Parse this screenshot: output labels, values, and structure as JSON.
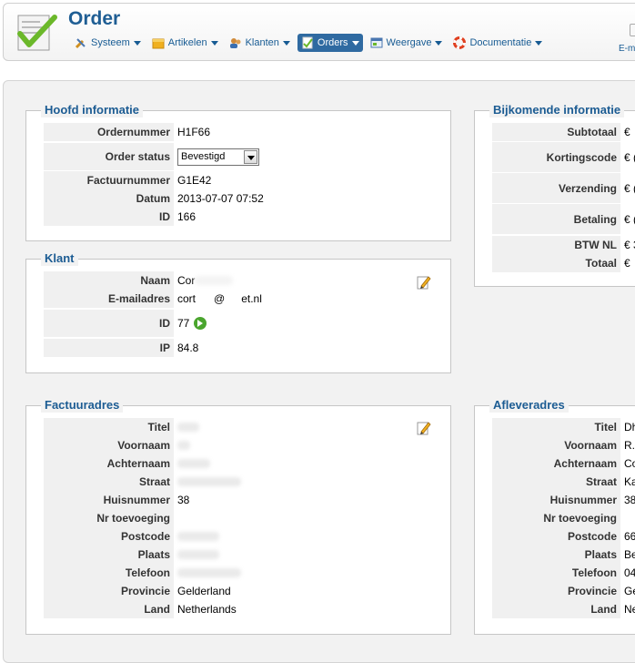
{
  "header": {
    "title": "Order",
    "email_link": "E-m"
  },
  "menu": [
    {
      "label": "Systeem",
      "icon": "tools-icon"
    },
    {
      "label": "Artikelen",
      "icon": "box-icon"
    },
    {
      "label": "Klanten",
      "icon": "users-icon"
    },
    {
      "label": "Orders",
      "icon": "orders-icon",
      "active": true
    },
    {
      "label": "Weergave",
      "icon": "view-icon"
    },
    {
      "label": "Documentatie",
      "icon": "lifebuoy-icon"
    }
  ],
  "hoofd": {
    "legend": "Hoofd informatie",
    "ordernummer_label": "Ordernummer",
    "ordernummer": "H1F66",
    "status_label": "Order status",
    "status": "Bevestigd",
    "factuurnummer_label": "Factuurnummer",
    "factuurnummer": "G1E42",
    "datum_label": "Datum",
    "datum": "2013-07-07 07:52",
    "id_label": "ID",
    "id": "166"
  },
  "bijkomend": {
    "legend": "Bijkomende informatie",
    "subtotaal_label": "Subtotaal",
    "subtotaal": "€",
    "kortingscode_label": "Kortingscode",
    "kortingscode": "€ (",
    "verzending_label": "Verzending",
    "verzending": "€ (",
    "betaling_label": "Betaling",
    "betaling": "€ (",
    "btw_label": "BTW NL",
    "btw": "€ 3",
    "totaal_label": "Totaal",
    "totaal": "€"
  },
  "klant": {
    "legend": "Klant",
    "naam_label": "Naam",
    "naam": "Cor",
    "email_label": "E-mailadres",
    "email_a": "cort",
    "email_b": "@",
    "email_c": "et.nl",
    "id_label": "ID",
    "id": "77",
    "ip_label": "IP",
    "ip": "84.8"
  },
  "factuuradres": {
    "legend": "Factuuradres",
    "titel_label": "Titel",
    "voornaam_label": "Voornaam",
    "achternaam_label": "Achternaam",
    "straat_label": "Straat",
    "huisnummer_label": "Huisnummer",
    "huisnummer": "38",
    "nr_toevoeging_label": "Nr toevoeging",
    "postcode_label": "Postcode",
    "plaats_label": "Plaats",
    "telefoon_label": "Telefoon",
    "provincie_label": "Provincie",
    "provincie": "Gelderland",
    "land_label": "Land",
    "land": "Netherlands"
  },
  "afleveradres": {
    "legend": "Afleveradres",
    "titel_label": "Titel",
    "titel": "Dh",
    "voornaam_label": "Voornaam",
    "voornaam": "R.",
    "achternaam_label": "Achternaam",
    "achternaam": "Co",
    "straat_label": "Straat",
    "straat": "Ka",
    "huisnummer_label": "Huisnummer",
    "huisnummer": "38",
    "nr_toevoeging_label": "Nr toevoeging",
    "postcode_label": "Postcode",
    "postcode": "66",
    "plaats_label": "Plaats",
    "plaats": "Be",
    "telefoon_label": "Telefoon",
    "telefoon": "04",
    "provincie_label": "Provincie",
    "provincie": "Ge",
    "land_label": "Land",
    "land": "Ne"
  }
}
